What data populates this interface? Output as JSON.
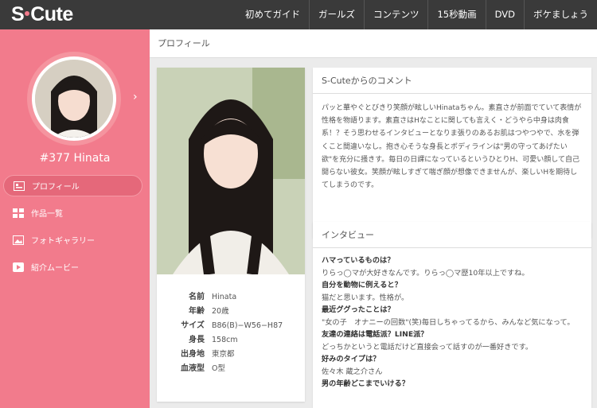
{
  "header": {
    "logo_left": "S",
    "logo_right": "Cute",
    "nav": [
      "初めてガイド",
      "ガールズ",
      "コンテンツ",
      "15秒動画",
      "DVD",
      "ボケましょう"
    ]
  },
  "sidebar": {
    "model_id": "#377 Hinata",
    "items": [
      {
        "label": "プロフィール",
        "icon": "profile-icon"
      },
      {
        "label": "作品一覧",
        "icon": "grid-icon"
      },
      {
        "label": "フォトギャラリー",
        "icon": "photo-icon"
      },
      {
        "label": "紹介ムービー",
        "icon": "play-icon"
      }
    ]
  },
  "breadcrumb": "プロフィール",
  "profile": {
    "rows": [
      {
        "key": "名前",
        "value": "Hinata"
      },
      {
        "key": "年齢",
        "value": "20歳"
      },
      {
        "key": "サイズ",
        "value": "B86(B)−W56−H87"
      },
      {
        "key": "身長",
        "value": "158cm"
      },
      {
        "key": "出身地",
        "value": "東京都"
      },
      {
        "key": "血液型",
        "value": "O型"
      }
    ]
  },
  "comment": {
    "title": "S-Cuteからのコメント",
    "text": "パッと華やぐとびきり笑顔が眩しいHinataちゃん。素直さが前面でていて表情が性格を物語ります。素直さはHなことに関しても言えく・どうやら中身は肉食系！？そう思わせるインタビューとなりま張りのあるお肌はつやつやで、水を弾くこと間違いなし。抱き心そうな身長とボディラインは\"男の守ってあげたい欲\"を充分に掻きす。毎日の日課になっているというひとりH、可愛い顔して自己開らない彼女。笑顔が眩しすぎて喘ぎ顔が想像できませんが、楽しいHを期待してしまうのです。"
  },
  "interview": {
    "title": "インタビュー",
    "qa": [
      {
        "q": "ハマっているものは？",
        "a": "りらっ◯マが大好きなんです。りらっ◯マ歴10年以上ですね。"
      },
      {
        "q": "自分を動物に例えると？",
        "a": "猫だと思います。性格が。"
      },
      {
        "q": "最近ググったことは？",
        "a": "\"女の子　オナニーの回数\"(笑)毎日しちゃってるから、みんなど気になって。"
      },
      {
        "q": "友達の連絡は電話派？LINE派？",
        "a": "どっちかというと電話だけど直接会って話すのが一番好きです。"
      },
      {
        "q": "好みのタイプは？",
        "a": "佐々木 蔵之介さん"
      },
      {
        "q": "男の年齢どこまでいける？",
        "a": ""
      }
    ]
  },
  "colors": {
    "accent": "#f27b8c",
    "topbar": "#3a3a3a",
    "active": "#e5687a"
  }
}
